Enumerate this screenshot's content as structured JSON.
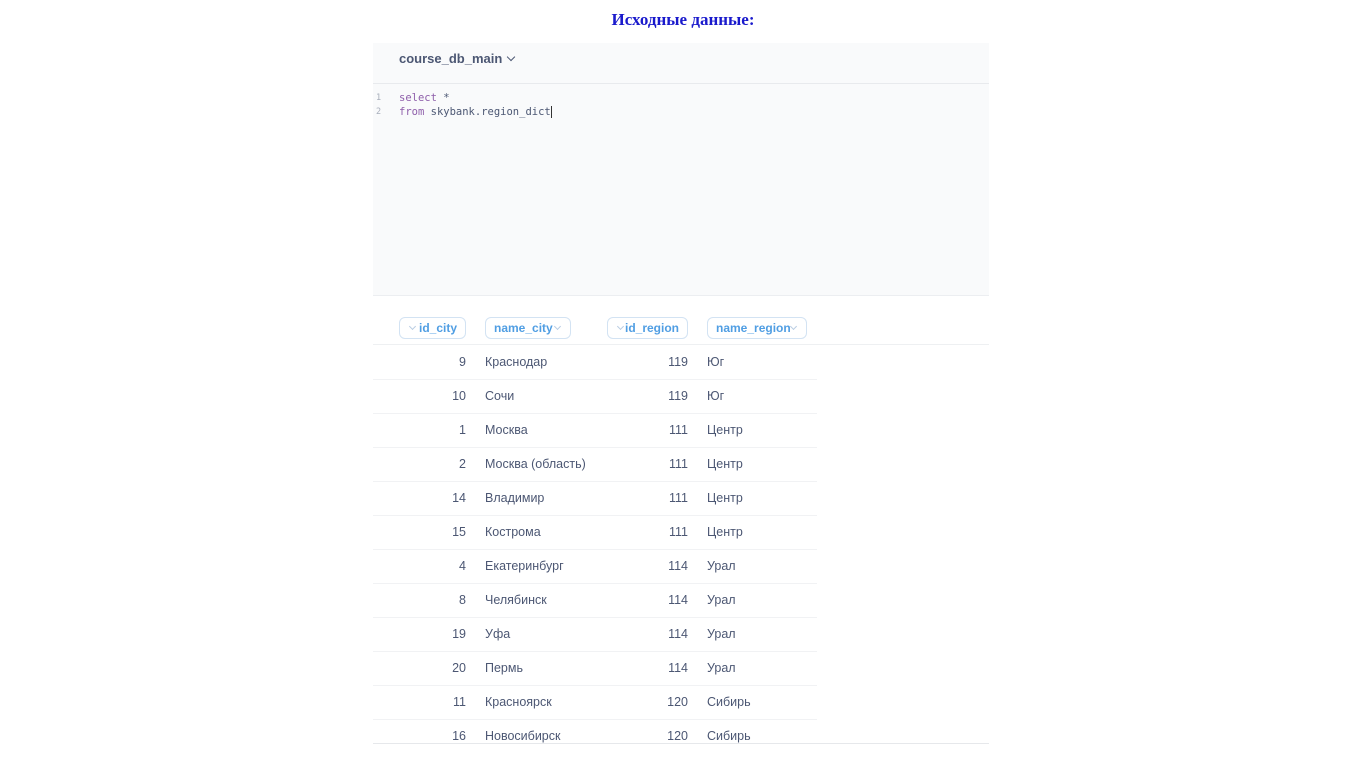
{
  "page": {
    "title": "Исходные данные:"
  },
  "editor": {
    "database": "course_db_main",
    "lines": [
      {
        "number": "1",
        "keyword": "select",
        "rest": " *"
      },
      {
        "number": "2",
        "keyword": "from",
        "rest": " skybank.region_dict"
      }
    ]
  },
  "results": {
    "columns": [
      "id_city",
      "name_city",
      "id_region",
      "name_region"
    ],
    "rows": [
      [
        "9",
        "Краснодар",
        "119",
        "Юг"
      ],
      [
        "10",
        "Сочи",
        "119",
        "Юг"
      ],
      [
        "1",
        "Москва",
        "111",
        "Центр"
      ],
      [
        "2",
        "Москва (область)",
        "111",
        "Центр"
      ],
      [
        "14",
        "Владимир",
        "111",
        "Центр"
      ],
      [
        "15",
        "Кострома",
        "111",
        "Центр"
      ],
      [
        "4",
        "Екатеринбург",
        "114",
        "Урал"
      ],
      [
        "8",
        "Челябинск",
        "114",
        "Урал"
      ],
      [
        "19",
        "Уфа",
        "114",
        "Урал"
      ],
      [
        "20",
        "Пермь",
        "114",
        "Урал"
      ],
      [
        "11",
        "Красноярск",
        "120",
        "Сибирь"
      ],
      [
        "16",
        "Новосибирск",
        "120",
        "Сибирь"
      ]
    ]
  },
  "colors": {
    "title": "#1a1acc",
    "accent": "#509ee3",
    "text": "#4c5773",
    "keyword": "#8e5eaa"
  }
}
